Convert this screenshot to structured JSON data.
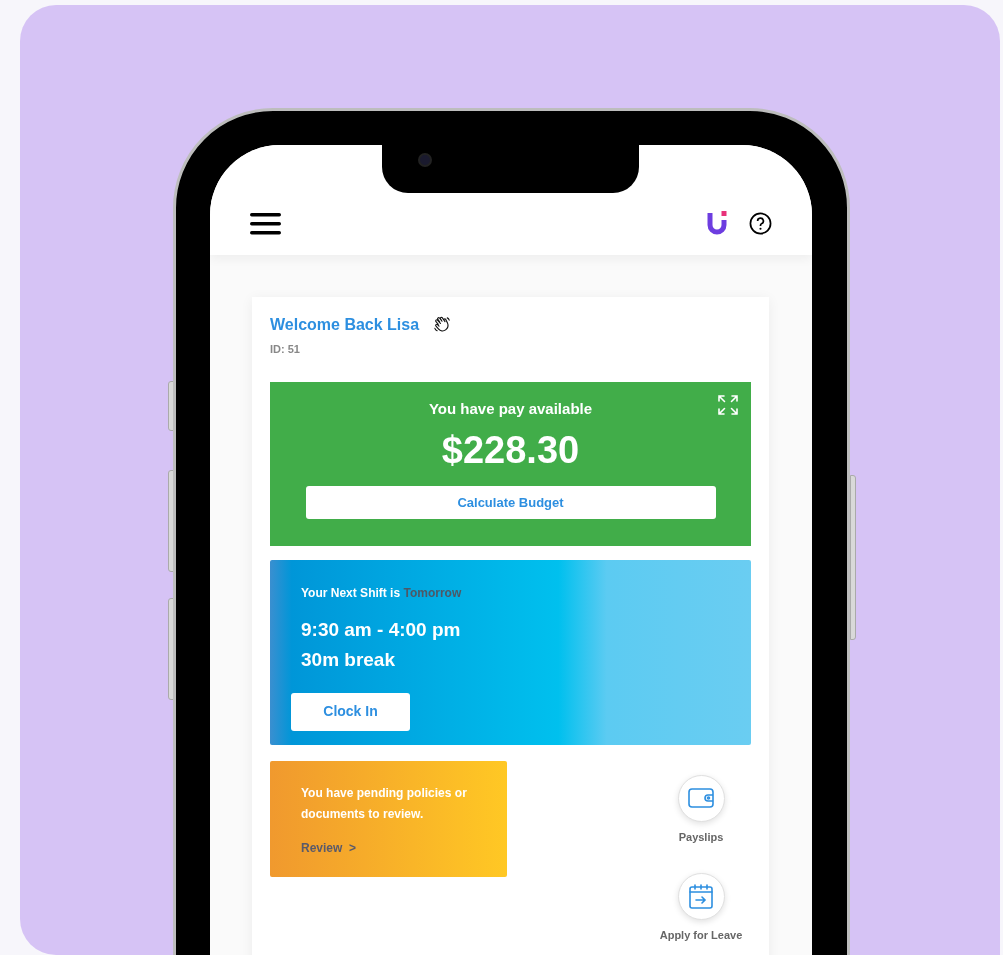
{
  "welcome": {
    "title": "Welcome Back Lisa",
    "id": "ID: 51"
  },
  "pay_card": {
    "label": "You have pay available",
    "amount": "$228.30",
    "button": "Calculate Budget"
  },
  "shift_card": {
    "prefix": "Your Next Shift is",
    "day": "Tomorrow",
    "time": "9:30 am - 4:00 pm",
    "break": "30m break",
    "button": "Clock In"
  },
  "notice_card": {
    "message": "You have pending policies or documents to review.",
    "link": "Review",
    "chevron": ">"
  },
  "shortcuts": [
    {
      "label": "Payslips",
      "kind": "wallet"
    },
    {
      "label": "Apply for Leave",
      "kind": "calendar"
    }
  ]
}
